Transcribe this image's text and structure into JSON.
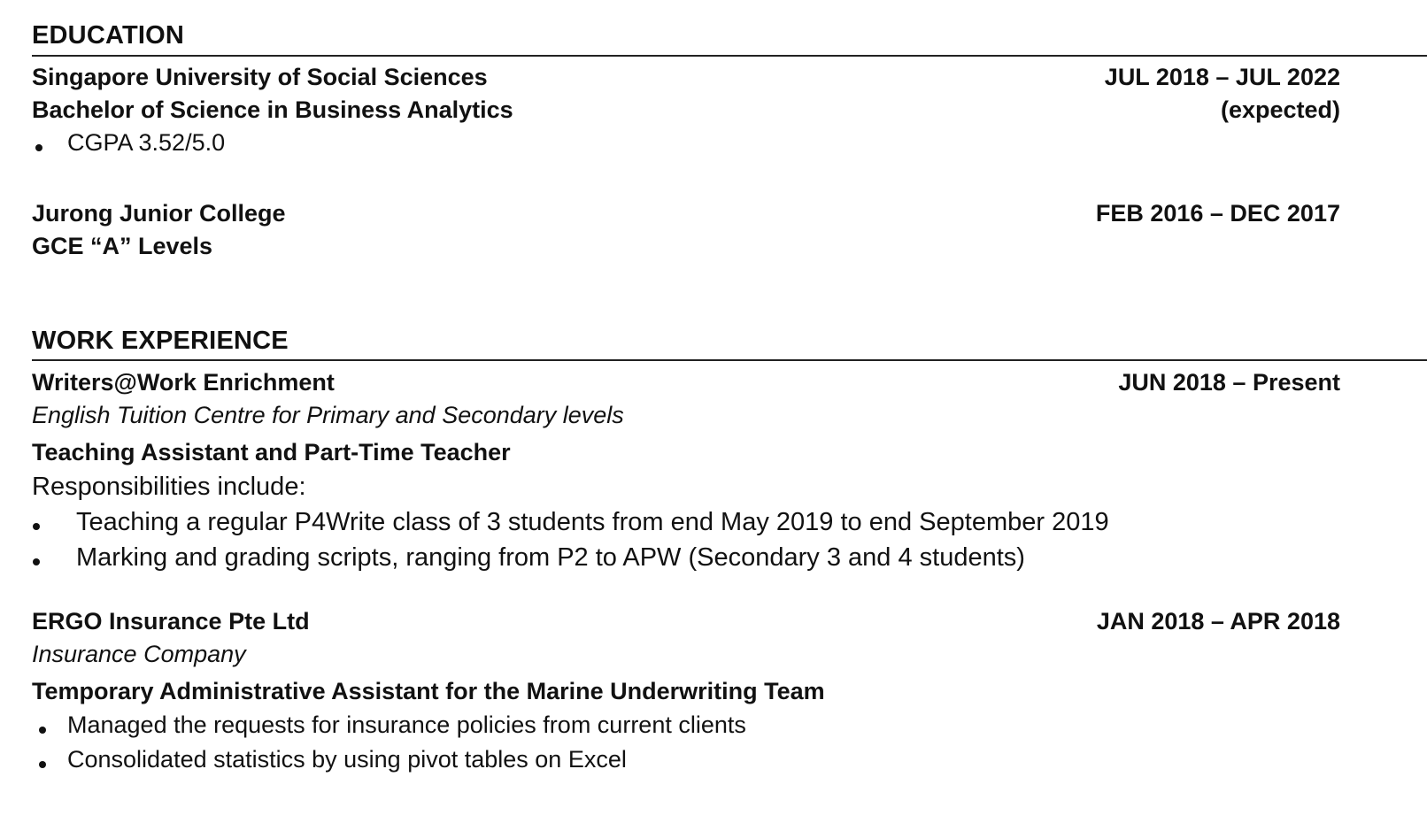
{
  "education": {
    "heading": "EDUCATION",
    "entries": [
      {
        "institution": "Singapore University of Social Sciences",
        "qualification": "Bachelor of Science in Business Analytics",
        "date": "JUL 2018 – JUL 2022",
        "date_note": "(expected)",
        "bullets": [
          "CGPA 3.52/5.0"
        ]
      },
      {
        "institution": "Jurong Junior College",
        "qualification": "GCE “A” Levels",
        "date": "FEB 2016 – DEC 2017"
      }
    ]
  },
  "work": {
    "heading": "WORK EXPERIENCE",
    "jobs": [
      {
        "company": "Writers@Work Enrichment",
        "description": "English Tuition Centre for Primary and Secondary levels",
        "date": "JUN 2018 – Present",
        "role": "Teaching Assistant and Part-Time Teacher",
        "lead": "Responsibilities include:",
        "bullets": [
          "Teaching a regular P4Write class of 3 students from end May 2019 to end September 2019",
          "Marking and grading scripts, ranging from P2 to APW (Secondary 3 and 4 students)"
        ]
      },
      {
        "company": "ERGO Insurance Pte Ltd",
        "description": "Insurance Company",
        "date": "JAN 2018 – APR 2018",
        "role": "Temporary Administrative Assistant for the Marine Underwriting Team",
        "bullets": [
          "Managed the requests for insurance policies from current clients",
          "Consolidated statistics by using pivot tables on Excel"
        ]
      }
    ]
  }
}
